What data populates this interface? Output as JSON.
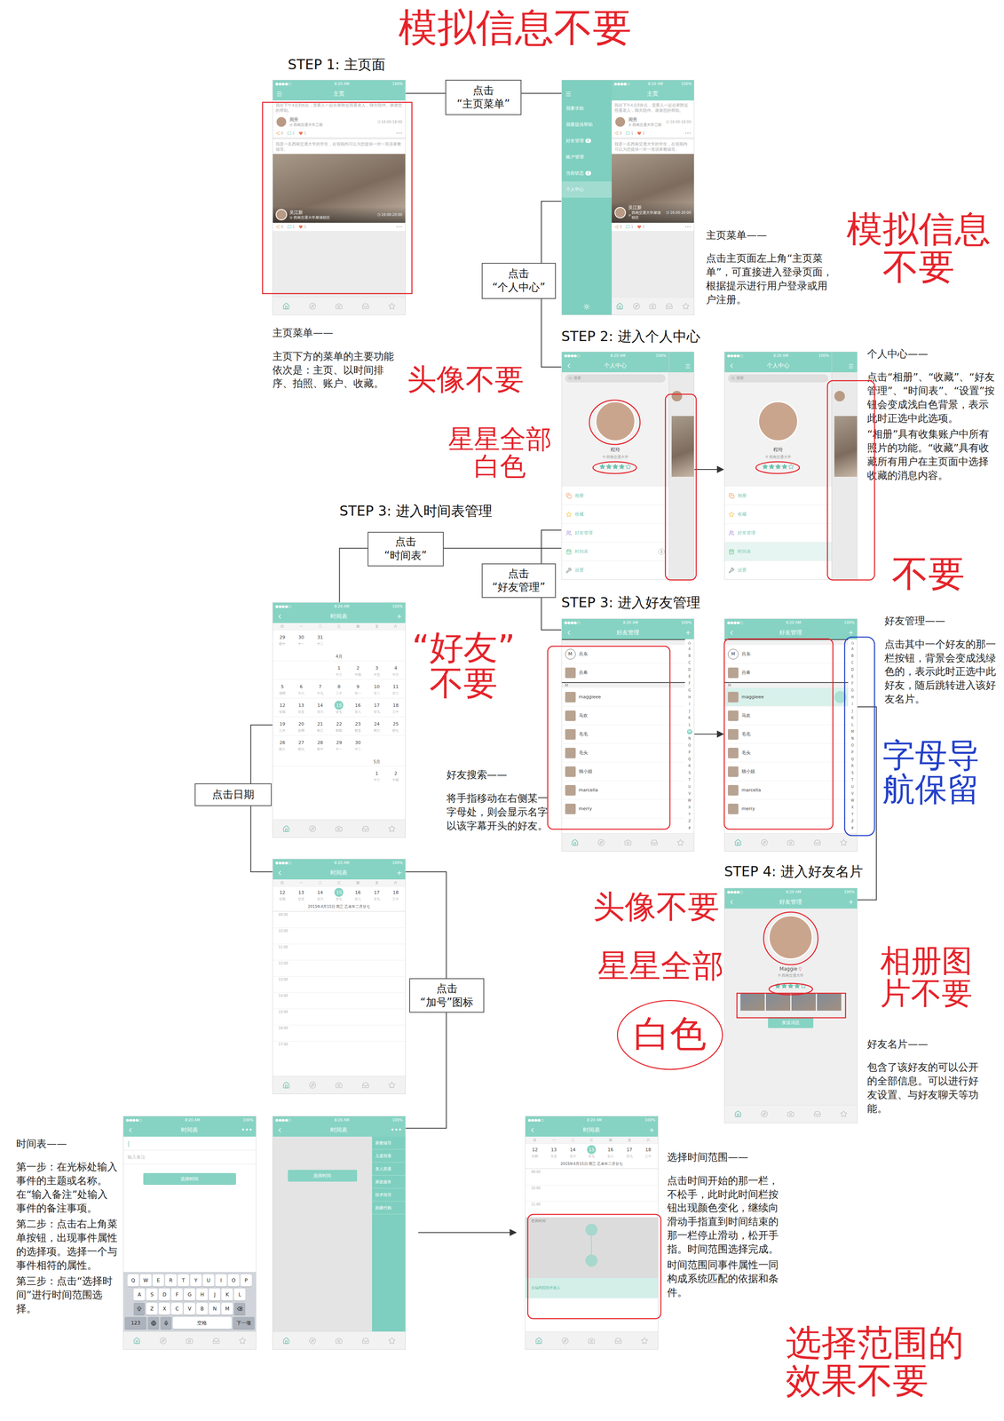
{
  "status_bar": {
    "signal": "●●●●○",
    "time": "8:20 AM",
    "battery": "100%"
  },
  "tab_bar": [
    {
      "selected": true
    },
    {
      "selected": false
    },
    {
      "selected": false
    },
    {
      "selected": false
    },
    {
      "selected": false
    }
  ],
  "steps": [
    "STEP 1: 主页面",
    "STEP 2: 进入个人中心",
    "STEP 3: 进入时间表管理",
    "STEP 3: 进入好友管理",
    "STEP 4: 进入好友名片"
  ],
  "actions": [
    [
      "点击",
      "“主页菜单”"
    ],
    [
      "点击",
      "“个人中心”"
    ],
    [
      "点击",
      "“时间表”"
    ],
    [
      "点击",
      "“好友管理”"
    ],
    [
      "点击日期"
    ],
    [
      "点击",
      "“加号”图标"
    ]
  ],
  "notes": [
    {
      "title": "主页菜单——",
      "paragraphs": [
        "点击主页面左上角“主页菜单”，可直接进入登录页面，根据提示进行用户登录或用户注册。"
      ]
    },
    {
      "title": "主页菜单——",
      "paragraphs": [
        "主页下方的菜单的主要功能依次是：主页、以时间排序、拍照、账户、收藏。"
      ]
    },
    {
      "title": "个人中心——",
      "paragraphs": [
        "点击“相册”、“收藏”、“好友管理”、“时间表”、“设置”按钮会变成浅白色背景，表示此时正选中此选项。",
        "“相册”具有收集账户中所有照片的功能。“收藏”具有收藏所有用户在主页面中选择收藏的消息内容。"
      ]
    },
    {
      "title": "好友管理——",
      "paragraphs": [
        "点击其中一个好友的那一栏按钮，背景会变成浅绿色的，表示此时正选中此好友，随后跳转进入该好友名片。"
      ]
    },
    {
      "title": "好友搜索——",
      "paragraphs": [
        "将手指移动在右侧某一字母处，则会显示名字以该字幕开头的好友。"
      ]
    },
    {
      "title": "好友名片——",
      "paragraphs": [
        "包含了该好友的可以公开的全部信息。可以进行好友设置、与好友聊天等功能。"
      ]
    },
    {
      "title": "时间表——",
      "paragraphs": [
        "第一步：在光标处输入事件的主题或名称。在“输入备注”处输入事件的备注事项。",
        "第二步：点击右上角菜单按钮，出现事件属性的选择项。选择一个与事件相符的属性。",
        "第三步：点击“选择时间”进行时间范围选择。"
      ]
    },
    {
      "title": "选择时间范围——",
      "paragraphs": [
        "点击时间开始的那一栏，不松手，此时此时间栏按钮出现颜色变化，继续向滑动手指直到时间结束的那一栏停止滑动，松开手指。时间范围选择完成。",
        "时间范围同事件属性一同构成系统匹配的依据和条件。"
      ]
    }
  ],
  "annotations": [
    {
      "lines": [
        "模拟信息不要"
      ],
      "color": "#e5232a"
    },
    {
      "lines": [
        "模拟信息",
        "不要"
      ],
      "color": "#e5232a"
    },
    {
      "lines": [
        "头像不要"
      ],
      "color": "#e5232a"
    },
    {
      "lines": [
        "星星全部",
        "白色"
      ],
      "color": "#e5232a"
    },
    {
      "lines": [
        "不要"
      ],
      "color": "#e5232a"
    },
    {
      "lines": [
        "“好友”",
        "不要"
      ],
      "color": "#e5232a"
    },
    {
      "lines": [
        "字母导",
        "航保留"
      ],
      "color": "#2340c8"
    },
    {
      "lines": [
        "头像不要"
      ],
      "color": "#e5232a"
    },
    {
      "lines": [
        "星星全部"
      ],
      "color": "#e5232a"
    },
    {
      "lines": [
        "白色"
      ],
      "color": "#e5232a"
    },
    {
      "lines": [
        "相册图",
        "片不要"
      ],
      "color": "#e5232a"
    },
    {
      "lines": [
        "选择范围的",
        "效果不要"
      ],
      "color": "#e5232a"
    }
  ],
  "home": {
    "title": "主页",
    "left": "menu",
    "posts": [
      {
        "text": "我在下午4点到6点，需要人一起在家附近照看老人，聊天陪伴。谢谢您的帮助。",
        "name": "周芳",
        "location": "西南交通大学三期",
        "time": "16:00-18:00",
        "counts": [
          "0",
          "1",
          "1"
        ],
        "more": "•••",
        "photo": false
      },
      {
        "text": "我是一名西南交通大学的学生，在假期内可以为您提供一对一英语家教辅导。",
        "name": "吴江新",
        "location": "西南交通大学犀浦校区",
        "time": "16:00-20:00",
        "counts": [
          "0",
          "1",
          "1"
        ],
        "more": "•••",
        "photo": true
      }
    ]
  },
  "menu": {
    "title": "主页",
    "left": "none",
    "items": [
      {
        "label": "我要求助",
        "badge": "",
        "selected": false
      },
      {
        "label": "我要提供帮助",
        "badge": "",
        "selected": false
      },
      {
        "label": "好友管理",
        "badge": "6",
        "selected": false
      },
      {
        "label": "账户管理",
        "badge": "",
        "selected": false
      },
      {
        "label": "当前状态",
        "badge": "3",
        "selected": false
      },
      {
        "label": "个人中心",
        "badge": "",
        "selected": true
      }
    ]
  },
  "profiles": [
    {
      "title": "个人中心",
      "left": "back",
      "search": "搜索",
      "name": "程玲",
      "location": "西南交通大学",
      "stars": 4,
      "rows": [
        {
          "label": "相册",
          "color": "#f29a5a",
          "selected": false,
          "badge": ""
        },
        {
          "label": "收藏",
          "color": "#f2c443",
          "selected": false,
          "badge": ""
        },
        {
          "label": "好友管理",
          "color": "#a58bd6",
          "selected": false,
          "badge": ""
        },
        {
          "label": "时间表",
          "color": "#6cc48f",
          "selected": false,
          "badge": "3"
        },
        {
          "label": "设置",
          "color": "#7d8a8a",
          "selected": false,
          "badge": ""
        }
      ]
    },
    {
      "title": "个人中心",
      "left": "back",
      "search": "搜索",
      "name": "程玲",
      "location": "西南交通大学",
      "stars": 4,
      "rows": [
        {
          "label": "相册",
          "color": "#f29a5a",
          "selected": false,
          "badge": ""
        },
        {
          "label": "收藏",
          "color": "#f2c443",
          "selected": false,
          "badge": ""
        },
        {
          "label": "好友管理",
          "color": "#a58bd6",
          "selected": false,
          "badge": ""
        },
        {
          "label": "时间表",
          "color": "#6cc48f",
          "selected": true,
          "badge": ""
        },
        {
          "label": "设置",
          "color": "#7d8a8a",
          "selected": false,
          "badge": ""
        }
      ]
    }
  ],
  "friends": [
    {
      "title": "好友管理",
      "left": "back",
      "right": "+",
      "touched": "M",
      "index": [
        "A",
        "B",
        "C",
        "D",
        "E",
        "F",
        "G",
        "H",
        "I",
        "J",
        "K",
        "L",
        "M",
        "N",
        "O",
        "P",
        "Q",
        "R",
        "S",
        "T",
        "U",
        "V",
        "W",
        "X",
        "Y",
        "Z",
        "#"
      ],
      "sections": [
        {
          "letter": "",
          "contacts": [
            {
              "name": "吕东",
              "badge": "M",
              "selected": false
            },
            {
              "name": "吕希",
              "badge": "",
              "selected": false
            }
          ]
        },
        {
          "letter": "M",
          "contacts": [
            {
              "name": "maggieee",
              "badge": "",
              "selected": false
            },
            {
              "name": "马欢",
              "badge": "",
              "selected": false
            },
            {
              "name": "毛毛",
              "badge": "",
              "selected": false
            },
            {
              "name": "毛头",
              "badge": "",
              "selected": false
            },
            {
              "name": "猫小姐",
              "badge": "",
              "selected": false
            },
            {
              "name": "marcella",
              "badge": "",
              "selected": false
            },
            {
              "name": "merry",
              "badge": "",
              "selected": false
            }
          ]
        }
      ]
    },
    {
      "title": "好友管理",
      "left": "back",
      "right": "+",
      "touched": "",
      "index": [
        "A",
        "B",
        "C",
        "D",
        "E",
        "F",
        "G",
        "H",
        "I",
        "J",
        "K",
        "L",
        "M",
        "N",
        "O",
        "P",
        "Q",
        "R",
        "S",
        "T",
        "U",
        "V",
        "W",
        "X",
        "Y",
        "Z",
        "#"
      ],
      "sections": [
        {
          "letter": "",
          "contacts": [
            {
              "name": "吕东",
              "badge": "M",
              "selected": false
            },
            {
              "name": "吕希",
              "badge": "",
              "selected": false
            }
          ]
        },
        {
          "letter": "M",
          "contacts": [
            {
              "name": "maggieee",
              "badge": "",
              "selected": true
            },
            {
              "name": "马欢",
              "badge": "",
              "selected": false
            },
            {
              "name": "毛毛",
              "badge": "",
              "selected": false
            },
            {
              "name": "毛头",
              "badge": "",
              "selected": false
            },
            {
              "name": "猫小姐",
              "badge": "",
              "selected": false
            },
            {
              "name": "marcella",
              "badge": "",
              "selected": false
            },
            {
              "name": "merry",
              "badge": "",
              "selected": false
            }
          ]
        }
      ]
    }
  ],
  "card": {
    "title": "好友管理",
    "left": "back",
    "right": "+",
    "name": "Maggie",
    "gender": "♀",
    "location": "西南交通大学",
    "stars": 4,
    "photos": 4,
    "button": "发送消息"
  },
  "month": {
    "title": "时间表",
    "left": "back",
    "right": "+",
    "weekdays": [
      "日",
      "一",
      "二",
      "三",
      "四",
      "五",
      "六"
    ],
    "blocks": [
      {
        "kind": "week",
        "days": [
          {
            "day": "29",
            "lunar": "初十",
            "selected": false
          },
          {
            "day": "30",
            "lunar": "十一",
            "selected": false
          },
          {
            "day": "31",
            "lunar": "十二",
            "selected": false
          },
          null,
          null,
          null,
          null
        ]
      },
      {
        "kind": "label",
        "text": "4月"
      },
      {
        "kind": "week",
        "days": [
          null,
          null,
          null,
          {
            "day": "1",
            "lunar": "十三",
            "selected": false
          },
          {
            "day": "2",
            "lunar": "十四",
            "selected": false
          },
          {
            "day": "3",
            "lunar": "十五",
            "selected": false
          },
          {
            "day": "4",
            "lunar": "十六",
            "selected": false
          }
        ]
      },
      {
        "kind": "week",
        "days": [
          {
            "day": "5",
            "lunar": "清明",
            "selected": false
          },
          {
            "day": "6",
            "lunar": "十八",
            "selected": false
          },
          {
            "day": "7",
            "lunar": "十九",
            "selected": false
          },
          {
            "day": "8",
            "lunar": "二十",
            "selected": false
          },
          {
            "day": "9",
            "lunar": "廿一",
            "selected": false
          },
          {
            "day": "10",
            "lunar": "廿二",
            "selected": false
          },
          {
            "day": "11",
            "lunar": "廿三",
            "selected": false
          }
        ]
      },
      {
        "kind": "week",
        "days": [
          {
            "day": "12",
            "lunar": "廿四",
            "selected": false
          },
          {
            "day": "13",
            "lunar": "廿五",
            "selected": false
          },
          {
            "day": "14",
            "lunar": "廿六",
            "selected": false
          },
          {
            "day": "15",
            "lunar": "廿七",
            "selected": true
          },
          {
            "day": "16",
            "lunar": "廿八",
            "selected": false
          },
          {
            "day": "17",
            "lunar": "廿九",
            "selected": false
          },
          {
            "day": "18",
            "lunar": "三十",
            "selected": false
          }
        ]
      },
      {
        "kind": "week",
        "days": [
          {
            "day": "19",
            "lunar": "三月",
            "selected": false
          },
          {
            "day": "20",
            "lunar": "谷雨",
            "selected": false
          },
          {
            "day": "21",
            "lunar": "初三",
            "selected": false
          },
          {
            "day": "22",
            "lunar": "初四",
            "selected": false
          },
          {
            "day": "23",
            "lunar": "初五",
            "selected": false
          },
          {
            "day": "24",
            "lunar": "初六",
            "selected": false
          },
          {
            "day": "25",
            "lunar": "初七",
            "selected": false
          }
        ]
      },
      {
        "kind": "week",
        "days": [
          {
            "day": "26",
            "lunar": "初八",
            "selected": false
          },
          {
            "day": "27",
            "lunar": "初九",
            "selected": false
          },
          {
            "day": "28",
            "lunar": "初十",
            "selected": false
          },
          {
            "day": "29",
            "lunar": "十一",
            "selected": false
          },
          {
            "day": "30",
            "lunar": "十二",
            "selected": false
          },
          null,
          null
        ]
      },
      {
        "kind": "label",
        "text": "5月"
      },
      {
        "kind": "week",
        "days": [
          null,
          null,
          null,
          null,
          null,
          {
            "day": "1",
            "lunar": "十三",
            "selected": false
          },
          {
            "day": "2",
            "lunar": "十四",
            "selected": false
          }
        ]
      }
    ]
  },
  "day": {
    "title": "时间表",
    "left": "back",
    "right": "+",
    "weekdays": [
      "日",
      "一",
      "二",
      "三",
      "四",
      "五",
      "六"
    ],
    "week": [
      {
        "day": "12",
        "lunar": "廿四",
        "selected": false
      },
      {
        "day": "13",
        "lunar": "廿五",
        "selected": false
      },
      {
        "day": "14",
        "lunar": "廿六",
        "selected": false
      },
      {
        "day": "15",
        "lunar": "廿七",
        "selected": true
      },
      {
        "day": "16",
        "lunar": "廿八",
        "selected": false
      },
      {
        "day": "17",
        "lunar": "廿九",
        "selected": false
      },
      {
        "day": "18",
        "lunar": "三十",
        "selected": false
      }
    ],
    "date_line": "2015年4月15日 周三 乙未年二月廿七",
    "hours": [
      "09:00",
      "10:00",
      "11:00",
      "12:00",
      "13:00",
      "14:00",
      "15:00",
      "16:00",
      "17:00"
    ]
  },
  "add_event": {
    "title": "时间表",
    "left": "back",
    "right": "•••",
    "cursor": "|",
    "note_placeholder": "输入备注",
    "button": "选择时间",
    "keyboard": {
      "rows": [
        [
          "Q",
          "W",
          "E",
          "R",
          "T",
          "Y",
          "U",
          "I",
          "O",
          "P"
        ],
        [
          "A",
          "S",
          "D",
          "F",
          "G",
          "H",
          "J",
          "K",
          "L"
        ],
        [
          "Z",
          "X",
          "C",
          "V",
          "B",
          "N",
          "M"
        ]
      ],
      "bottom": [
        {
          "kind": "text",
          "label": "123"
        },
        {
          "kind": "globe",
          "label": ""
        },
        {
          "kind": "mic",
          "label": ""
        },
        {
          "kind": "space",
          "label": "空格"
        },
        {
          "kind": "text",
          "label": "下一项"
        }
      ]
    }
  },
  "properties": {
    "title": "时间表",
    "left": "back",
    "right": "•••",
    "button": "选择时间",
    "options": [
      "家教辅导",
      "儿童照看",
      "老人照看",
      "家政服务",
      "技术指导",
      "跑腿代购"
    ]
  },
  "range": {
    "title": "时间表",
    "left": "back",
    "right": "+",
    "weekdays": [
      "日",
      "一",
      "二",
      "三",
      "四",
      "五",
      "六"
    ],
    "week": [
      {
        "day": "12",
        "lunar": "廿四",
        "selected": false
      },
      {
        "day": "13",
        "lunar": "廿五",
        "selected": false
      },
      {
        "day": "14",
        "lunar": "廿六",
        "selected": false
      },
      {
        "day": "15",
        "lunar": "廿七",
        "selected": true
      },
      {
        "day": "16",
        "lunar": "廿八",
        "selected": false
      },
      {
        "day": "17",
        "lunar": "廿九",
        "selected": false
      },
      {
        "day": "18",
        "lunar": "三十",
        "selected": false
      }
    ],
    "date_line": "2015年4月15日 周三 乙未年二月廿七",
    "hours": [
      "09:00",
      "10:00",
      "11:00"
    ],
    "selection": {
      "free_label": "空闲时间",
      "event_label": "去福利院陪伴老人"
    }
  }
}
